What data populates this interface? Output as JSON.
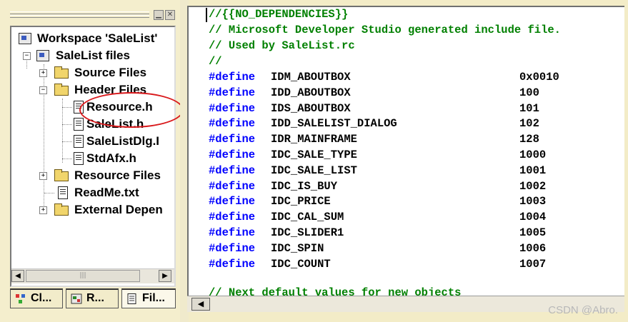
{
  "workspace": {
    "tree": [
      {
        "label": "Workspace 'SaleList'",
        "icon": "workspace-icon"
      },
      {
        "label": "SaleList files",
        "icon": "project-icon"
      },
      {
        "label": "Source Files",
        "icon": "folder-icon"
      },
      {
        "label": "Header Files",
        "icon": "folder-open-icon"
      },
      {
        "label": "Resource.h",
        "icon": "file-icon"
      },
      {
        "label": "SaleList.h",
        "icon": "file-icon"
      },
      {
        "label": "SaleListDlg.I",
        "icon": "file-icon"
      },
      {
        "label": "StdAfx.h",
        "icon": "file-icon"
      },
      {
        "label": "Resource Files",
        "icon": "folder-icon"
      },
      {
        "label": "ReadMe.txt",
        "icon": "file-icon"
      },
      {
        "label": "External Depen",
        "icon": "folder-icon"
      }
    ],
    "scroll_thumb_glyph": "|||",
    "tabs": [
      {
        "label": "Cl...",
        "icon": "class-view-icon"
      },
      {
        "label": "R...",
        "icon": "resource-view-icon"
      },
      {
        "label": "Fil...",
        "icon": "file-view-icon"
      }
    ],
    "colors": {
      "annotation": "#d9191c"
    }
  },
  "editor": {
    "header_lines": [
      "//{{NO_DEPENDENCIES}}",
      "// Microsoft Developer Studio generated include file.",
      "// Used by SaleList.rc",
      "//"
    ],
    "defines": [
      {
        "keyword": "#define",
        "name": "IDM_ABOUTBOX",
        "value": "0x0010"
      },
      {
        "keyword": "#define",
        "name": "IDD_ABOUTBOX",
        "value": "100"
      },
      {
        "keyword": "#define",
        "name": "IDS_ABOUTBOX",
        "value": "101"
      },
      {
        "keyword": "#define",
        "name": "IDD_SALELIST_DIALOG",
        "value": "102"
      },
      {
        "keyword": "#define",
        "name": "IDR_MAINFRAME",
        "value": "128"
      },
      {
        "keyword": "#define",
        "name": "IDC_SALE_TYPE",
        "value": "1000"
      },
      {
        "keyword": "#define",
        "name": "IDC_SALE_LIST",
        "value": "1001"
      },
      {
        "keyword": "#define",
        "name": "IDC_IS_BUY",
        "value": "1002"
      },
      {
        "keyword": "#define",
        "name": "IDC_PRICE",
        "value": "1003"
      },
      {
        "keyword": "#define",
        "name": "IDC_CAL_SUM",
        "value": "1004"
      },
      {
        "keyword": "#define",
        "name": "IDC_SLIDER1",
        "value": "1005"
      },
      {
        "keyword": "#define",
        "name": "IDC_SPIN",
        "value": "1006"
      },
      {
        "keyword": "#define",
        "name": "IDC_COUNT",
        "value": "1007"
      }
    ],
    "trailing_line": "// Next default values for new objects",
    "colors": {
      "keyword": "#0000ff",
      "comment": "#008000"
    }
  },
  "watermark": "CSDN @Abro."
}
